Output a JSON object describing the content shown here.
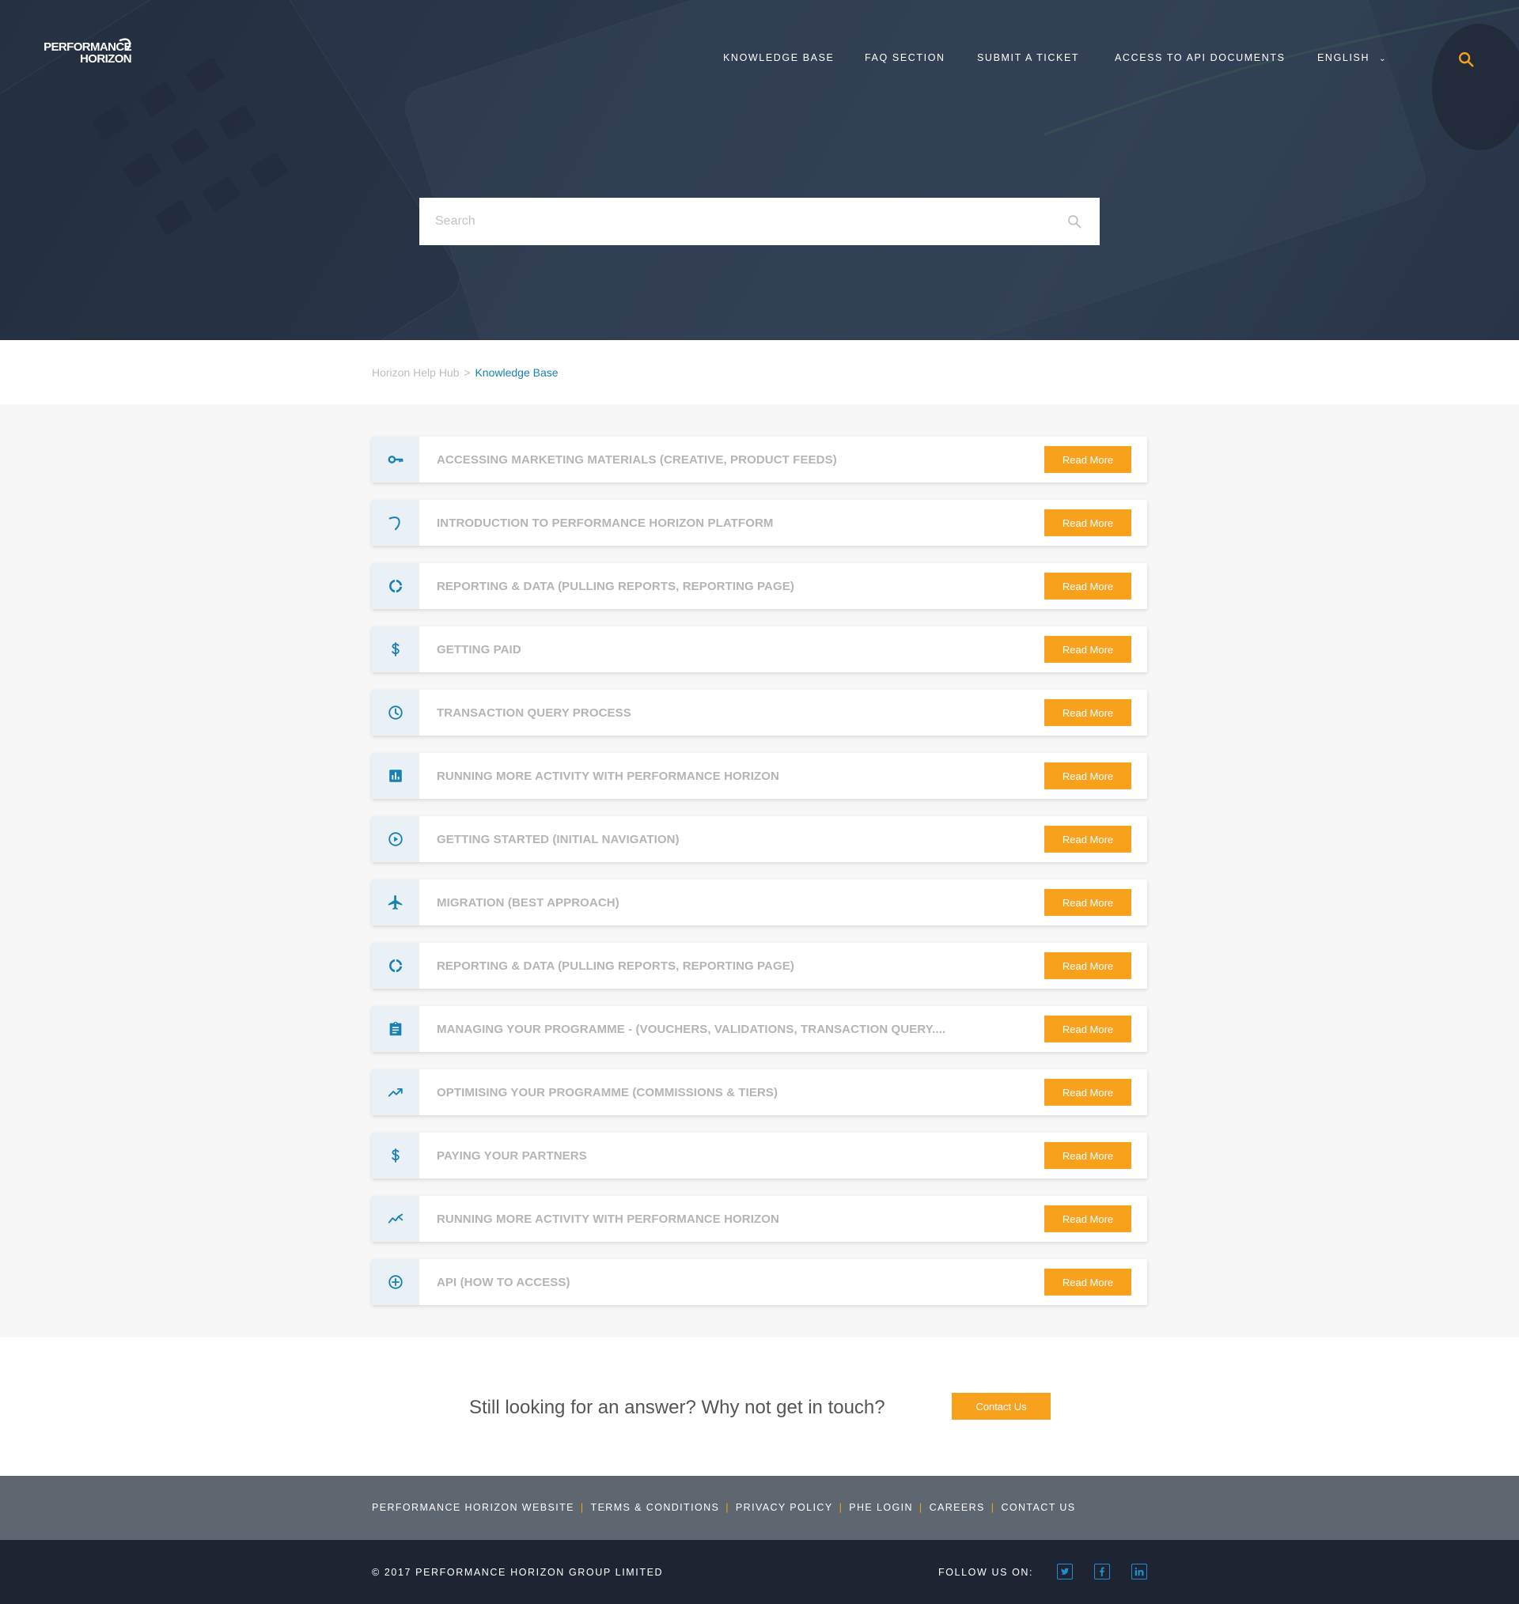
{
  "brand": {
    "logo_line1": "PERFORMANCE",
    "logo_line2": "HORIZON"
  },
  "nav": {
    "items": [
      "KNOWLEDGE BASE",
      "FAQ SECTION",
      "SUBMIT A TICKET",
      "ACCESS TO API DOCUMENTS"
    ],
    "language": "ENGLISH"
  },
  "hero": {
    "search_placeholder": "Search"
  },
  "breadcrumb": {
    "root": "Horizon Help Hub",
    "separator": ">",
    "current": "Knowledge Base"
  },
  "articles": [
    {
      "icon": "key-icon",
      "title": "ACCESSING MARKETING MATERIALS (CREATIVE, PRODUCT FEEDS)",
      "button": "Read More"
    },
    {
      "icon": "swoosh-icon",
      "title": "INTRODUCTION TO PERFORMANCE HORIZON PLATFORM",
      "button": "Read More"
    },
    {
      "icon": "donut-chart-icon",
      "title": "REPORTING & DATA (PULLING REPORTS, REPORTING PAGE)",
      "button": "Read More"
    },
    {
      "icon": "dollar-icon",
      "title": "GETTING PAID",
      "button": "Read More"
    },
    {
      "icon": "clock-icon",
      "title": "TRANSACTION QUERY PROCESS",
      "button": "Read More"
    },
    {
      "icon": "bar-chart-icon",
      "title": "RUNNING MORE ACTIVITY WITH PERFORMANCE HORIZON",
      "button": "Read More"
    },
    {
      "icon": "play-circle-icon",
      "title": "GETTING STARTED (INITIAL NAVIGATION)",
      "button": "Read More"
    },
    {
      "icon": "airplane-icon",
      "title": "MIGRATION (BEST APPROACH)",
      "button": "Read More"
    },
    {
      "icon": "donut-chart-icon",
      "title": "REPORTING & DATA (PULLING REPORTS, REPORTING PAGE)",
      "button": "Read More"
    },
    {
      "icon": "clipboard-icon",
      "title": "MANAGING YOUR PROGRAMME - (VOUCHERS, VALIDATIONS, TRANSACTION QUERY....",
      "button": "Read More"
    },
    {
      "icon": "trending-up-icon",
      "title": "OPTIMISING YOUR PROGRAMME (COMMISSIONS & TIERS)",
      "button": "Read More"
    },
    {
      "icon": "dollar-icon",
      "title": "PAYING YOUR PARTNERS",
      "button": "Read More"
    },
    {
      "icon": "line-chart-icon",
      "title": "RUNNING MORE ACTIVITY WITH PERFORMANCE HORIZON",
      "button": "Read More"
    },
    {
      "icon": "plus-circle-icon",
      "title": "API (HOW TO ACCESS)",
      "button": "Read More"
    }
  ],
  "contact": {
    "question": "Still looking for an answer? Why not get in touch?",
    "button": "Contact Us"
  },
  "footer": {
    "links": [
      "PERFORMANCE HORIZON WEBSITE",
      "TERMS & CONDITIONS",
      "PRIVACY POLICY",
      "PHE LOGIN",
      "CAREERS",
      "CONTACT US"
    ],
    "copyright": "© 2017 PERFORMANCE HORIZON GROUP LIMITED",
    "follow": "FOLLOW US ON:",
    "social": [
      "twitter-icon",
      "facebook-icon",
      "linkedin-icon"
    ]
  },
  "colors": {
    "accent": "#f7a11d",
    "link": "#1a7fb5",
    "icon": "#1a7fb5",
    "hero_bg": "#2f3c50",
    "footer_top": "#5e6670",
    "footer_bottom": "#1e2431"
  }
}
